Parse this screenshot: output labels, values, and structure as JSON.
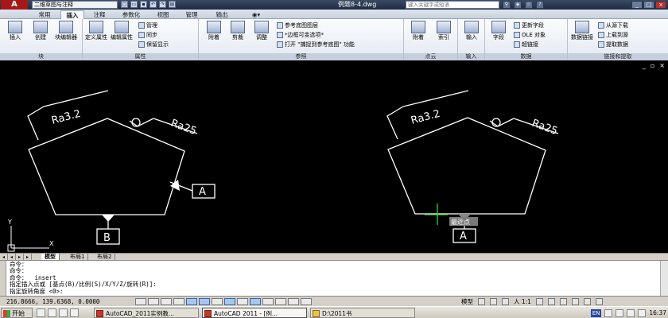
{
  "titlebar": {
    "logo": "A",
    "workspace": "二维草图与注释",
    "document_title": "例题8-4.dwg",
    "search_placeholder": "键入关键字或短语",
    "quick_access_icons": [
      "new-icon",
      "open-icon",
      "save-icon",
      "undo-icon",
      "redo-icon",
      "plot-icon"
    ]
  },
  "ribbon_tabs": [
    {
      "label": "常用",
      "active": false
    },
    {
      "label": "插入",
      "active": true
    },
    {
      "label": "注释",
      "active": false
    },
    {
      "label": "参数化",
      "active": false
    },
    {
      "label": "视图",
      "active": false
    },
    {
      "label": "管理",
      "active": false
    },
    {
      "label": "输出",
      "active": false
    }
  ],
  "ribbon": {
    "block_panel": {
      "title": "块",
      "insert": "插入",
      "create": "创建",
      "editor": "块编辑器"
    },
    "attributes_panel": {
      "title": "属性",
      "define": "定义属性",
      "edit": "编辑属性",
      "manage": "管理",
      "sync": "同步",
      "keep_display": "保留显示"
    },
    "reference_panel": {
      "title": "参照",
      "attach": "附着",
      "clip": "剪裁",
      "adjust": "调整",
      "underlay_layers": "参考底图图层",
      "frames_vary": "*边框可变选项*",
      "snap_underlays": "打开 \"捕捉到参考底图\" 功能"
    },
    "pointcloud_panel": {
      "title": "点云",
      "attach": "附着",
      "index": "索引"
    },
    "import_panel": {
      "title": "输入",
      "import": "输入"
    },
    "data_panel": {
      "title": "数据",
      "field": "字段",
      "update_fields": "更新字段",
      "ole_object": "OLE 对象",
      "hyperlink": "超链接"
    },
    "linking_panel": {
      "title": "链接和提取",
      "data_link": "数据链接",
      "download_source": "从源下载",
      "upload_source": "上载到源",
      "extract_data": "提取数据"
    }
  },
  "viewport": {
    "minimize": "_",
    "restore": "▫",
    "close": "×"
  },
  "drawing": {
    "left_part": {
      "roughness_1": "Ra3.2",
      "roughness_2": "Ra25",
      "datum_a": "A",
      "datum_b": "B"
    },
    "right_part": {
      "roughness_1": "Ra3.2",
      "roughness_2": "Ra25",
      "datum_a": "A",
      "snap_tooltip": "最近点"
    },
    "ucs": {
      "x": "X",
      "y": "Y"
    }
  },
  "layout_tabs": [
    "模型",
    "布局1",
    "布局2"
  ],
  "command": {
    "lines": [
      "命令：",
      "命令：",
      "命令：  insert",
      "指定插入点或 [基点(B)/比例(S)/X/Y/Z/旋转(R)]:",
      "指定旋转角度 <0>:"
    ]
  },
  "status": {
    "coordinates": "216.8666, 139.6368, 0.0000",
    "model": "模型",
    "scale": "人 1:1",
    "time_label": "16:37"
  },
  "taskbar": {
    "start": "开始",
    "tasks": [
      "AutoCAD_2011实例教...",
      "AutoCAD 2011 - [例...",
      "D:\\2011书"
    ],
    "lang": "EN",
    "clock": "16:37"
  }
}
